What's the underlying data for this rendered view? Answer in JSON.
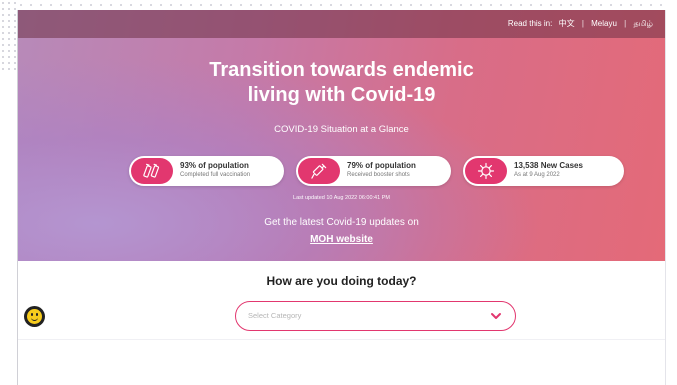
{
  "language_bar": {
    "prefix": "Read this in:",
    "languages": [
      "中文",
      "Melayu",
      "தமிழ்"
    ]
  },
  "hero": {
    "title_line1": "Transition towards endemic",
    "title_line2": "living with Covid-19",
    "subtitle": "COVID-19 Situation at a Glance",
    "stats": [
      {
        "icon": "vaccine-vials-icon",
        "headline": "93% of population",
        "detail": "Completed full vaccination"
      },
      {
        "icon": "syringe-icon",
        "headline": "79% of population",
        "detail": "Received booster shots"
      },
      {
        "icon": "virus-icon",
        "headline": "13,538 New Cases",
        "detail": "As at 9 Aug 2022"
      }
    ],
    "last_updated": "Last updated 10 Aug 2022 06:00:41 PM",
    "latest_text": "Get the latest Covid-19 updates on",
    "moh_link": "MOH website"
  },
  "wellbeing": {
    "question": "How are you doing today?",
    "select_placeholder": "Select Category"
  },
  "colors": {
    "accent": "#e2376f",
    "hero_start": "#b78ab9",
    "hero_end": "#e46a78"
  }
}
